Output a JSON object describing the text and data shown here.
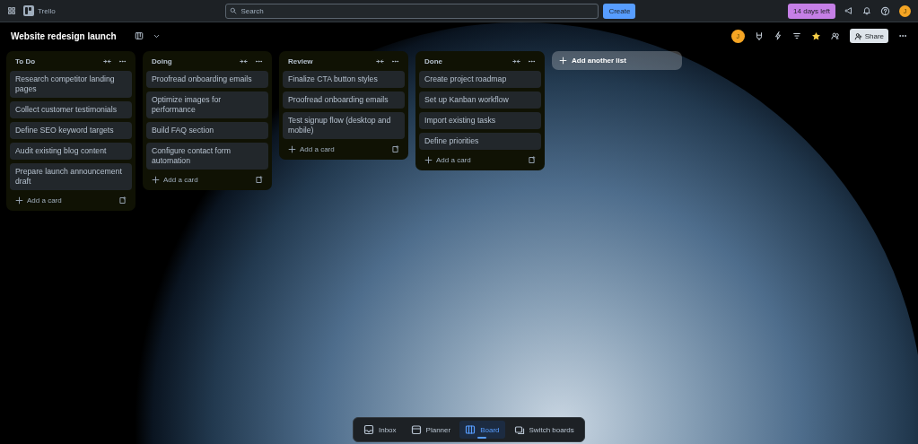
{
  "topbar": {
    "app_name": "Trello",
    "search": {
      "placeholder": "Search"
    },
    "create_button": "Create",
    "trial_badge": "14 days left",
    "avatar_initial": "J"
  },
  "board": {
    "title": "Website redesign launch",
    "member_initial": "J",
    "share_button": "Share"
  },
  "lists": [
    {
      "title": "To Do",
      "cards": [
        "Research competitor landing pages",
        "Collect customer testimonials",
        "Define SEO keyword targets",
        "Audit existing blog content",
        "Prepare launch announcement draft"
      ],
      "add_card": "Add a card"
    },
    {
      "title": "Doing",
      "cards": [
        "Proofread onboarding emails",
        "Optimize images for performance",
        "Build FAQ section",
        "Configure contact form automation"
      ],
      "add_card": "Add a card"
    },
    {
      "title": "Review",
      "cards": [
        "Finalize CTA button styles",
        "Proofread onboarding emails",
        "Test signup flow (desktop and mobile)"
      ],
      "add_card": "Add a card"
    },
    {
      "title": "Done",
      "cards": [
        "Create project roadmap",
        "Set up Kanban workflow",
        "Import existing tasks",
        "Define priorities"
      ],
      "add_card": "Add a card"
    }
  ],
  "add_list": "Add another list",
  "bottom_nav": [
    {
      "kind": "inbox",
      "label": "Inbox",
      "selected": false
    },
    {
      "kind": "planner",
      "label": "Planner",
      "selected": false
    },
    {
      "kind": "board",
      "label": "Board",
      "selected": true
    },
    {
      "kind": "switch",
      "label": "Switch boards",
      "selected": false
    }
  ]
}
